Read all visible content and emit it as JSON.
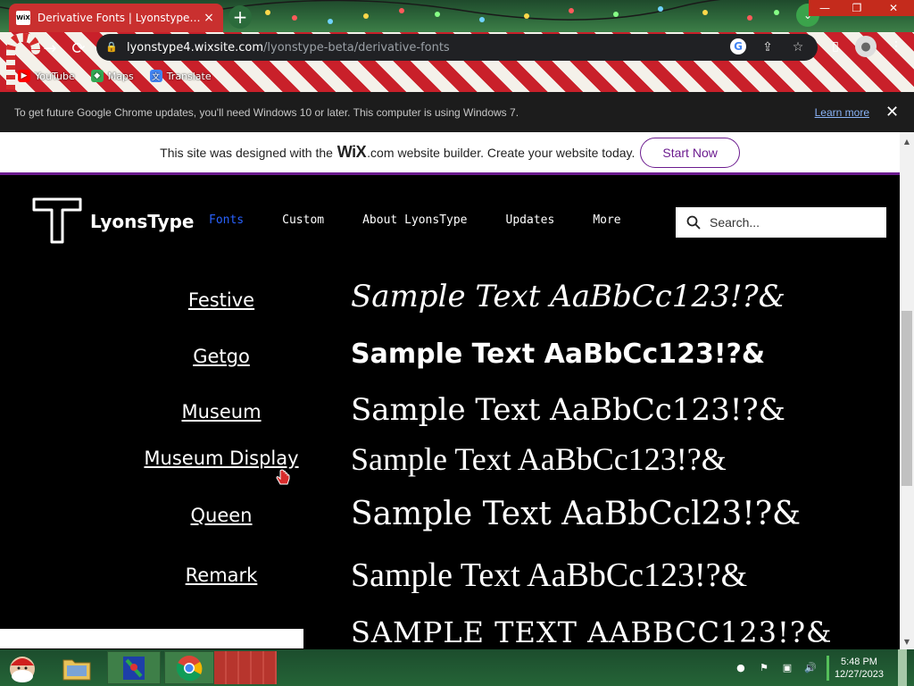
{
  "browser": {
    "tab_title": "Derivative Fonts | Lyonstype Beta",
    "tab_favicon": "WiX",
    "url_host": "lyonstype4.wixsite.com",
    "url_path": "/lyonstype-beta/derivative-fonts",
    "bookmarks": [
      {
        "label": "YouTube",
        "icon": "youtube-icon",
        "color": "#ff0000"
      },
      {
        "label": "Maps",
        "icon": "maps-icon",
        "color": "#34a853"
      },
      {
        "label": "Translate",
        "icon": "translate-icon",
        "color": "#4285f4"
      }
    ],
    "infobar": {
      "text": "To get future Google Chrome updates, you'll need Windows 10 or later. This computer is using Windows 7.",
      "learn_more": "Learn more"
    }
  },
  "wix_banner": {
    "prefix": "This site was designed with the",
    "logo": "WiX",
    "dotcom": ".com",
    "suffix": "website builder. Create your website today.",
    "cta": "Start Now",
    "accent": "#6c1c8f"
  },
  "site": {
    "brand": "LyonsType",
    "nav": [
      {
        "label": "Fonts",
        "active": true
      },
      {
        "label": "Custom",
        "active": false
      },
      {
        "label": "About LyonsType",
        "active": false
      },
      {
        "label": "Updates",
        "active": false
      },
      {
        "label": "More",
        "active": false
      }
    ],
    "search_placeholder": "Search...",
    "active_color": "#2962ff",
    "fonts": [
      {
        "name": "Festive",
        "sample": "Sample Text AaBbCc123!?&"
      },
      {
        "name": "Getgo",
        "sample": "Sample Text AaBbCc123!?&"
      },
      {
        "name": "Museum",
        "sample": "Sample Text AaBbCc123!?&"
      },
      {
        "name": "Museum Display",
        "sample": "Sample Text AaBbCc123!?&"
      },
      {
        "name": "Queen",
        "sample": "Sample Text AaBbCcl23!?&"
      },
      {
        "name": "Remark",
        "sample": "Sample Text AaBbCc123!?&"
      },
      {
        "name": "",
        "sample": "SAMPLE TEXT AABBCC123!?&"
      }
    ]
  },
  "taskbar": {
    "time": "5:48 PM",
    "date": "12/27/2023"
  }
}
